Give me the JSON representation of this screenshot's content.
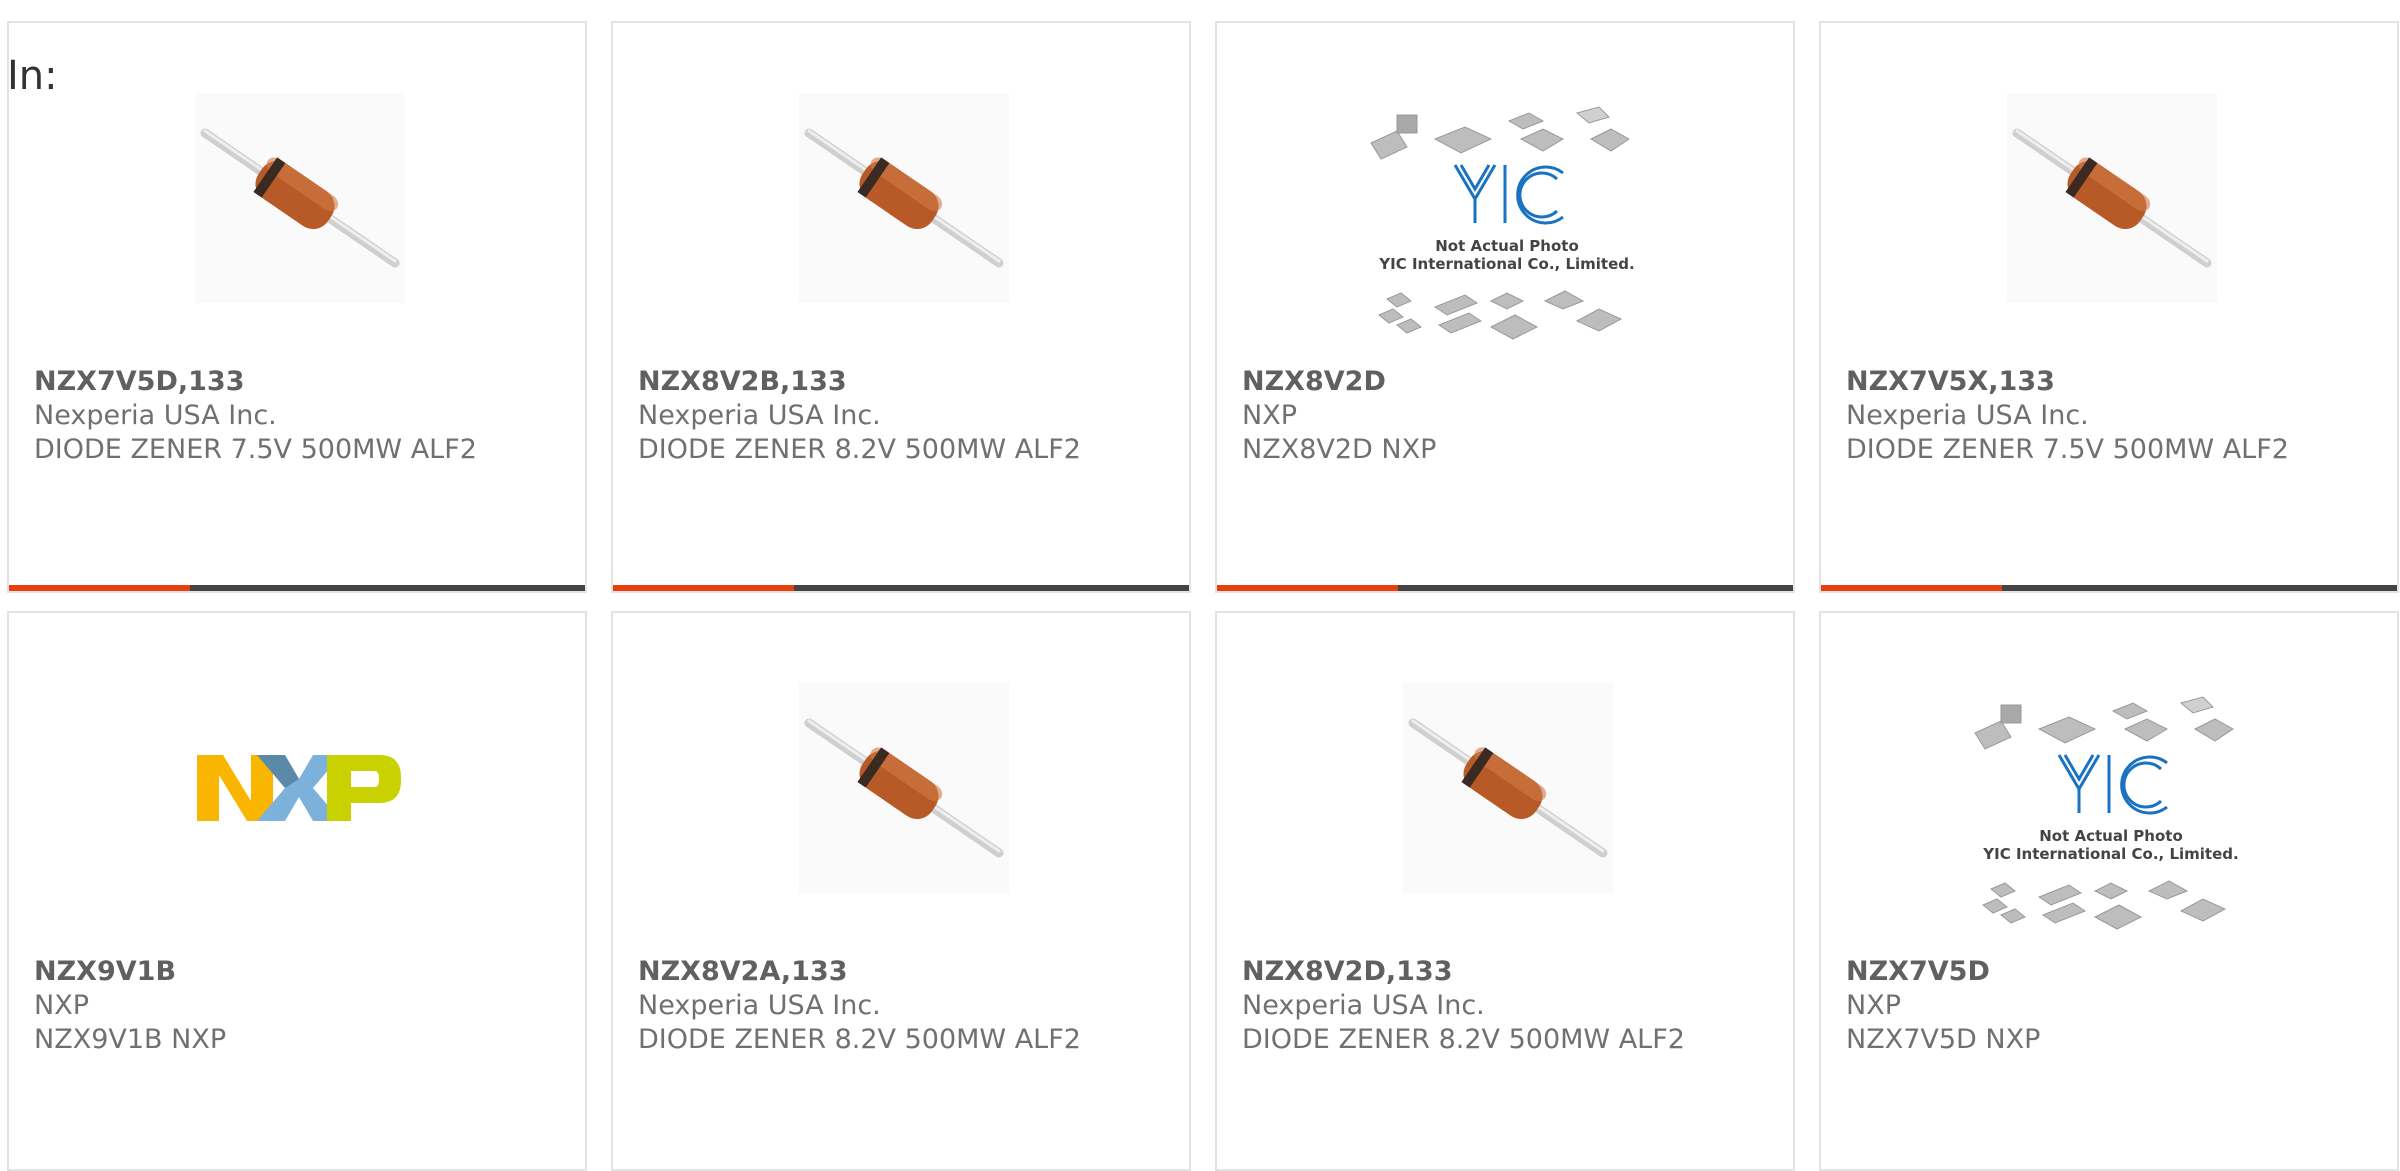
{
  "page": {
    "in_label": "In:"
  },
  "colors": {
    "accent": "#e8400c",
    "bar": "#444444",
    "border": "#e3e3e3",
    "text": "#707070"
  },
  "cards": [
    {
      "part": "NZX7V5D,133",
      "manufacturer": "Nexperia USA Inc.",
      "description": "DIODE ZENER 7.5V 500MW ALF2",
      "image": "diode-image"
    },
    {
      "part": "NZX8V2B,133",
      "manufacturer": "Nexperia USA Inc.",
      "description": "DIODE ZENER 8.2V 500MW ALF2",
      "image": "diode-image"
    },
    {
      "part": "NZX8V2D",
      "manufacturer": "NXP",
      "description": "NZX8V2D NXP",
      "image": "placeholder-image",
      "image_text": [
        "Not Actual Photo",
        "YIC International Co., Limited."
      ]
    },
    {
      "part": "NZX7V5X,133",
      "manufacturer": "Nexperia USA Inc.",
      "description": "DIODE ZENER 7.5V 500MW ALF2",
      "image": "diode-image"
    },
    {
      "part": "NZX9V1B",
      "manufacturer": "NXP",
      "description": "NZX9V1B NXP",
      "image": "nxp-logo"
    },
    {
      "part": "NZX8V2A,133",
      "manufacturer": "Nexperia USA Inc.",
      "description": "DIODE ZENER 8.2V 500MW ALF2",
      "image": "diode-image"
    },
    {
      "part": "NZX8V2D,133",
      "manufacturer": "Nexperia USA Inc.",
      "description": "DIODE ZENER 8.2V 500MW ALF2",
      "image": "diode-image"
    },
    {
      "part": "NZX7V5D",
      "manufacturer": "NXP",
      "description": "NZX7V5D NXP",
      "image": "placeholder-image",
      "image_text": [
        "Not Actual Photo",
        "YIC International Co., Limited."
      ]
    }
  ]
}
